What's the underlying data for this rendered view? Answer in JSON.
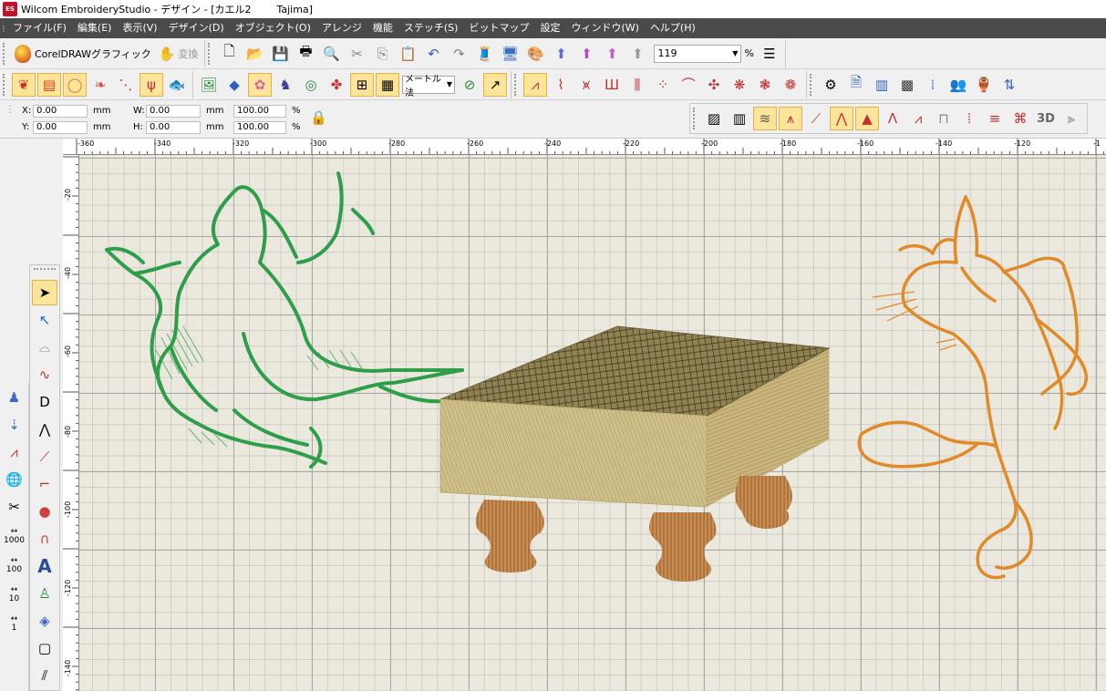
{
  "titlebar": {
    "app_icon": "ES",
    "title": "Wilcom EmbroideryStudio - デザイン - [カエル2        Tajima]"
  },
  "menu": [
    "ファイル(F)",
    "編集(E)",
    "表示(V)",
    "デザイン(D)",
    "オブジェクト(O)",
    "アレンジ",
    "機能",
    "ステッチ(S)",
    "ビットマップ",
    "設定",
    "ウィンドウ(W)",
    "ヘルプ(H)"
  ],
  "toolbar": {
    "corel_label": "CorelDRAWグラフィック",
    "convert_label": "変換",
    "zoom_value": "119",
    "zoom_unit": "%",
    "method_select": "メートル法"
  },
  "position": {
    "x_label": "X:",
    "x_value": "0.00",
    "y_label": "Y:",
    "y_value": "0.00",
    "w_label": "W:",
    "w_value": "0.00",
    "h_label": "H:",
    "h_value": "0.00",
    "unit": "mm",
    "scale_w": "100.00",
    "scale_h": "100.00",
    "pct": "%"
  },
  "ruler_h": [
    "-360",
    "-340",
    "-320",
    "-300",
    "-280",
    "-260",
    "-240",
    "-220",
    "-200",
    "-180",
    "-160",
    "-140",
    "-120",
    "-1"
  ],
  "ruler_v": [
    "-20",
    "-40",
    "-60",
    "-80",
    "-100",
    "-120",
    "-140"
  ],
  "left_numbers": [
    "1000",
    "100",
    "10",
    "1"
  ],
  "stitch_label_3d": "3D",
  "colors": {
    "frog": "#2e9e4a",
    "rabbit": "#e08a2a",
    "board": "#cdbb84",
    "legs": "#c98d52",
    "accent": "#fce49a"
  }
}
